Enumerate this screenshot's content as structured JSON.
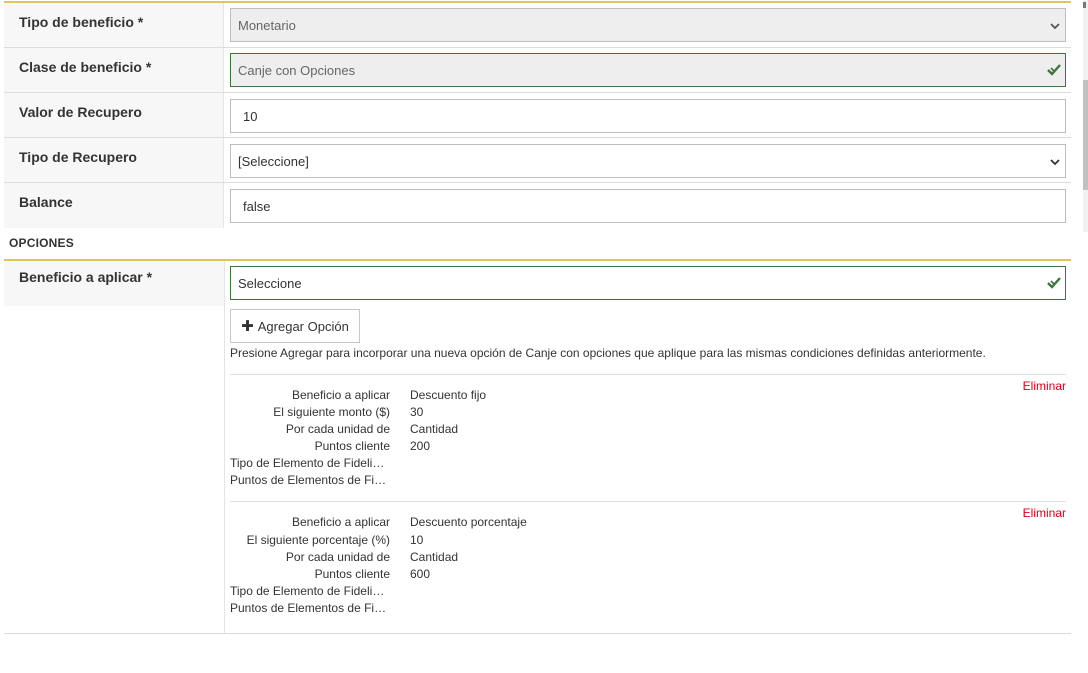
{
  "rows": [
    {
      "label": "Tipo de beneficio *",
      "value": "Monetario"
    },
    {
      "label": "Clase de beneficio *",
      "value": "Canje con Opciones"
    },
    {
      "label": "Valor de Recupero",
      "value": "10"
    },
    {
      "label": "Tipo de Recupero",
      "value": "[Seleccione]"
    },
    {
      "label": "Balance",
      "value": "false"
    }
  ],
  "options_section": {
    "title": "OPCIONES",
    "benefit_label": "Beneficio a aplicar *",
    "benefit_value": "Seleccione",
    "add_button": "Agregar Opción",
    "help_text": "Presione Agregar para incorporar una nueva opción de Canje con opciones que aplique para las mismas condiciones definidas anteriormente."
  },
  "options": [
    {
      "delete_label": "Eliminar",
      "fields": [
        {
          "key": "Beneficio a aplicar",
          "value": "Descuento fijo"
        },
        {
          "key": "El siguiente monto ($)",
          "value": "30"
        },
        {
          "key": "Por cada unidad de",
          "value": "Cantidad"
        },
        {
          "key": "Puntos cliente",
          "value": "200"
        }
      ],
      "truncated_fields": [
        "Tipo de Elemento de Fidelización",
        "Puntos de Elementos de Fidelización"
      ]
    },
    {
      "delete_label": "Eliminar",
      "fields": [
        {
          "key": "Beneficio a aplicar",
          "value": "Descuento porcentaje"
        },
        {
          "key": "El siguiente porcentaje (%)",
          "value": "10"
        },
        {
          "key": "Por cada unidad de",
          "value": "Cantidad"
        },
        {
          "key": "Puntos cliente",
          "value": "600"
        }
      ],
      "truncated_fields": [
        "Tipo de Elemento de Fidelización",
        "Puntos de Elementos de Fidelización"
      ]
    }
  ],
  "colors": {
    "accent_line": "#e0c65a",
    "valid": "#3c763d",
    "danger": "#d9001b"
  },
  "icons": {
    "select": "chevron-down-icon",
    "valid": "check-icon",
    "add": "plus-icon"
  }
}
